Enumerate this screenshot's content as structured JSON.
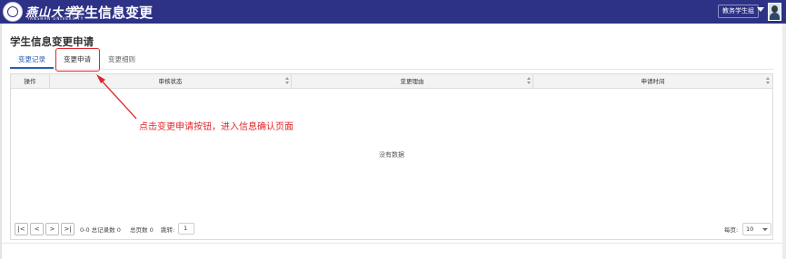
{
  "header": {
    "logo_text": "燕山大学",
    "logo_sub": "YANSHAN UNIVERSITY",
    "title": "学生信息变更",
    "user_role": "教务学生组"
  },
  "page": {
    "title": "学生信息变更申请"
  },
  "tabs": [
    {
      "label": "变更记录",
      "active": true
    },
    {
      "label": "变更申请",
      "active": false
    },
    {
      "label": "变更细则",
      "active": false
    }
  ],
  "table": {
    "columns": [
      "操作",
      "审核状态",
      "变更理由",
      "申请时间"
    ],
    "empty_text": "没有数据"
  },
  "pagination": {
    "first": "|<",
    "prev": "<",
    "next": ">",
    "last": ">|",
    "range_text": "0-0 总记录数 0",
    "total_pages_text": "总页数 0",
    "jump_label": "跳转:",
    "jump_value": "1",
    "per_page_label": "每页:",
    "per_page_value": "10"
  },
  "annotation": {
    "text": "点击变更申请按钮，进入信息确认页面",
    "color": "#e0262a"
  },
  "colors": {
    "header_bg": "#2d3286",
    "accent": "#2d5eb3"
  }
}
